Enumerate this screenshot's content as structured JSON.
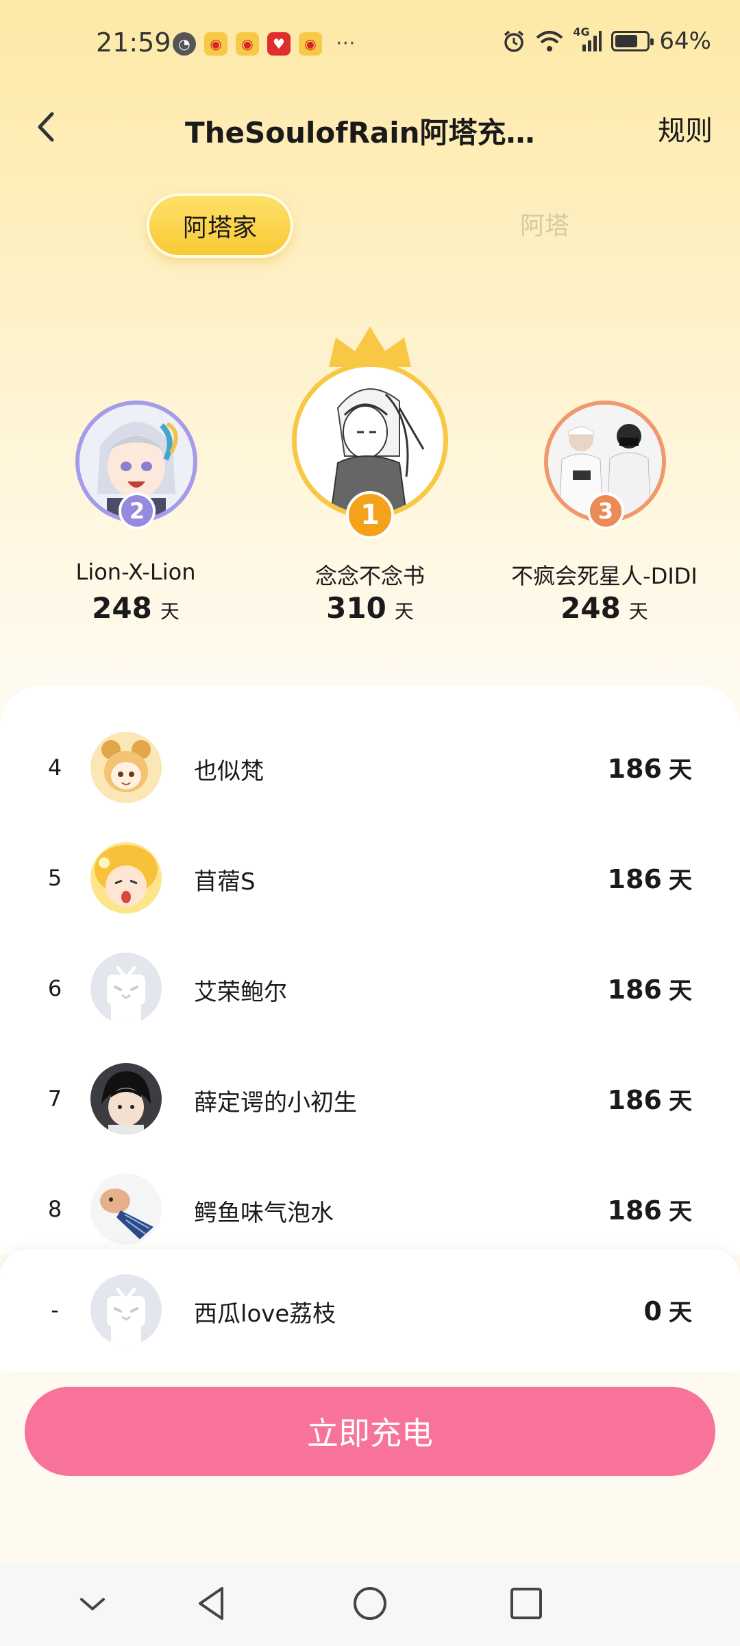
{
  "status_bar": {
    "time": "21:59",
    "dots": "···",
    "network": "4G",
    "battery": "64%",
    "battery_level": 0.64
  },
  "header": {
    "title": "TheSoulofRain阿塔充电...",
    "rules": "规则"
  },
  "tabs": [
    {
      "label": "阿塔家",
      "active": true
    },
    {
      "label": "阿塔",
      "active": false
    }
  ],
  "podium": [
    {
      "rank": "2",
      "name": "Lion-X-Lion",
      "days": "248",
      "unit": "天"
    },
    {
      "rank": "1",
      "name": "念念不念书",
      "days": "310",
      "unit": "天"
    },
    {
      "rank": "3",
      "name": "不疯会死星人-DIDI",
      "days": "248",
      "unit": "天"
    }
  ],
  "list": [
    {
      "rank": "4",
      "name": "也似梵",
      "days": "186",
      "unit": "天"
    },
    {
      "rank": "5",
      "name": "苜蓿S",
      "days": "186",
      "unit": "天"
    },
    {
      "rank": "6",
      "name": "艾荣鲍尔",
      "days": "186",
      "unit": "天"
    },
    {
      "rank": "7",
      "name": "薛定谔的小初生",
      "days": "186",
      "unit": "天"
    },
    {
      "rank": "8",
      "name": "鳄鱼味气泡水",
      "days": "186",
      "unit": "天"
    }
  ],
  "self_row": {
    "rank": "-",
    "name": "西瓜love荔枝",
    "days": "0",
    "unit": "天"
  },
  "charge_button": "立即充电",
  "colors": {
    "accent_pink": "#f7739a",
    "tab_yellow": "#f9c935",
    "gold": "#f5a623",
    "silver": "#9b8fe0",
    "bronze": "#ee8f5e"
  }
}
